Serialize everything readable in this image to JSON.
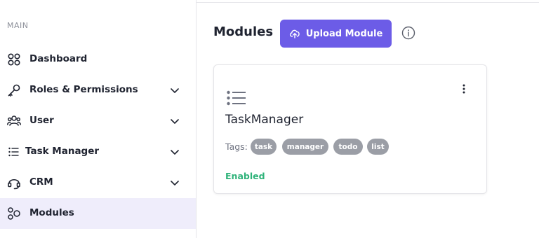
{
  "sidebar": {
    "section_label": "MAIN",
    "items": [
      {
        "label": "Dashboard",
        "icon": "dashboard-icon",
        "has_chevron": false,
        "active": false
      },
      {
        "label": "Roles & Permissions",
        "icon": "key-icon",
        "has_chevron": true,
        "active": false
      },
      {
        "label": "User",
        "icon": "users-icon",
        "has_chevron": true,
        "active": false
      },
      {
        "label": "Task Manager",
        "icon": "list-icon",
        "has_chevron": true,
        "active": false
      },
      {
        "label": "CRM",
        "icon": "headset-icon",
        "has_chevron": true,
        "active": false
      },
      {
        "label": "Modules",
        "icon": "modules-icon",
        "has_chevron": false,
        "active": true
      }
    ]
  },
  "main": {
    "title": "Modules",
    "upload_button": "Upload Module",
    "card": {
      "icon": "list-icon",
      "title": "TaskManager",
      "tags_label": "Tags:",
      "tags": [
        "task",
        "manager",
        "todo",
        "list"
      ],
      "status": "Enabled"
    }
  },
  "colors": {
    "accent": "#6c5ce7",
    "active_background": "#efedfb",
    "enabled": "#2fb37a",
    "tag_background": "#9b9ea6"
  }
}
